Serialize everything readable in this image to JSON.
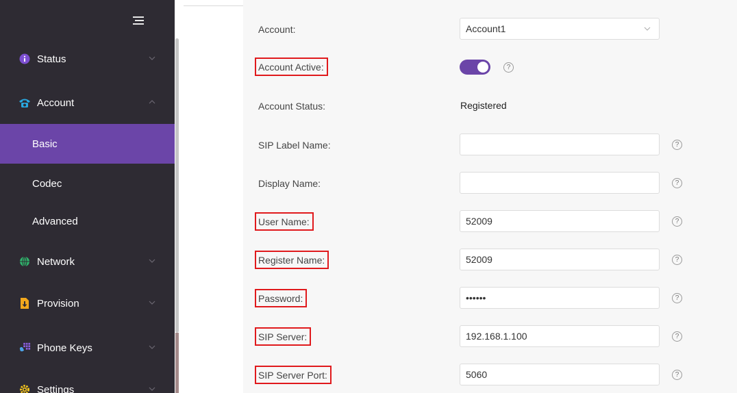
{
  "sidebar": {
    "items": [
      {
        "label": "Status",
        "icon": "info-icon",
        "expanded": false
      },
      {
        "label": "Account",
        "icon": "phone-icon",
        "expanded": true
      },
      {
        "label": "Network",
        "icon": "globe-icon",
        "expanded": false
      },
      {
        "label": "Provision",
        "icon": "download-icon",
        "expanded": false
      },
      {
        "label": "Phone Keys",
        "icon": "keypad-icon",
        "expanded": false
      },
      {
        "label": "Settings",
        "icon": "gear-icon",
        "expanded": false
      }
    ],
    "sub_items": [
      {
        "label": "Basic",
        "active": true
      },
      {
        "label": "Codec",
        "active": false
      },
      {
        "label": "Advanced",
        "active": false
      }
    ],
    "accent": "#6b45a8",
    "background": "#2e2b33"
  },
  "form": {
    "account": {
      "label": "Account:",
      "value": "Account1"
    },
    "account_active": {
      "label": "Account Active:",
      "value": true
    },
    "account_status": {
      "label": "Account Status:",
      "value": "Registered"
    },
    "sip_label_name": {
      "label": "SIP Label Name:",
      "value": ""
    },
    "display_name": {
      "label": "Display Name:",
      "value": ""
    },
    "user_name": {
      "label": "User Name:",
      "value": "52009"
    },
    "register_name": {
      "label": "Register Name:",
      "value": "52009"
    },
    "password": {
      "label": "Password:",
      "value": "••••••"
    },
    "sip_server": {
      "label": "SIP Server:",
      "value": "192.168.1.100"
    },
    "sip_server_port": {
      "label": "SIP Server Port:",
      "value": "5060"
    },
    "help_glyph": "?",
    "highlight_color": "#e0191c"
  }
}
